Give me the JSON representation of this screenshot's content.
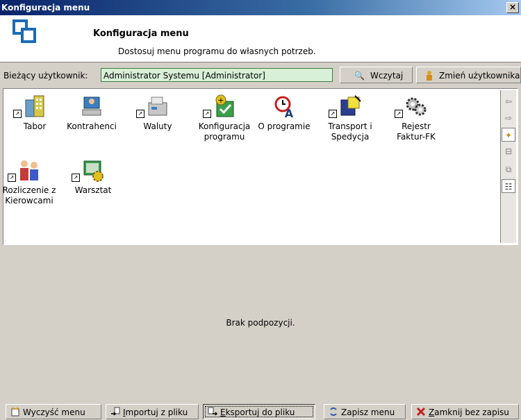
{
  "window": {
    "title": "Konfiguracja menu",
    "close_glyph": "×"
  },
  "header": {
    "title": "Konfiguracja menu",
    "subtitle": "Dostosuj menu programu do własnych potrzeb."
  },
  "user_row": {
    "label": "Bieżący użytkownik:",
    "value": "Administrator Systemu [Administrator]",
    "load_button": "Wczytaj",
    "change_user_button": "Zmień użytkownika"
  },
  "menu_items": [
    {
      "label": "Tabor",
      "icon": "buildings-icon"
    },
    {
      "label": "Kontrahenci",
      "icon": "contacts-icon"
    },
    {
      "label": "Waluty",
      "icon": "currency-icon"
    },
    {
      "label": "Konfiguracja programu",
      "icon": "config-icon"
    },
    {
      "label": "O programie",
      "icon": "about-icon"
    },
    {
      "label": "Transport i Spedycja",
      "icon": "transport-icon"
    },
    {
      "label": "Rejestr Faktur-FK",
      "icon": "gears-icon"
    },
    {
      "label": "Rozliczenie z Kierowcami",
      "icon": "people-icon"
    },
    {
      "label": "Warsztat",
      "icon": "workshop-icon"
    }
  ],
  "sidebar_icons": [
    "arrow-left-icon",
    "arrow-right-icon",
    "new-folder-icon",
    "rename-icon",
    "copy-icon",
    "tree-icon"
  ],
  "sublist": {
    "empty_text": "Brak podpozycji."
  },
  "bottom": {
    "clear": "Wyczyść menu",
    "import_u": "I",
    "import_rest": "mportuj z pliku",
    "export_u": "E",
    "export_rest": "ksportuj do pliku",
    "save": "Zapisz menu",
    "close_u": "Z",
    "close_rest": "amknij bez zapisu"
  },
  "colors": {
    "title_bar": "#0a246a",
    "user_box": "#d9f0d8",
    "panel_bg": "#d4d0c8",
    "accent_red": "#c81e1e"
  }
}
